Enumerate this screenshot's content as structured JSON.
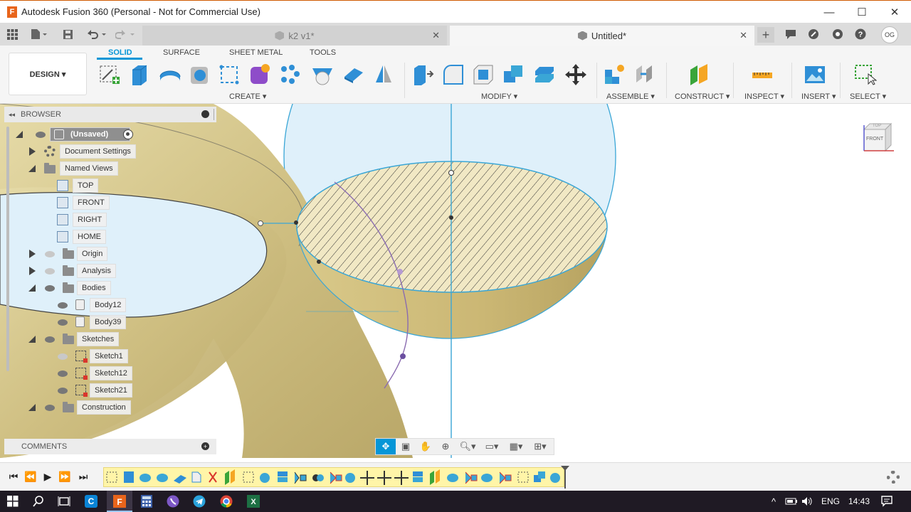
{
  "window": {
    "title": "Autodesk Fusion 360 (Personal - Not for Commercial Use)",
    "logo_letter": "F",
    "controls": [
      "—",
      "☐",
      "✕"
    ]
  },
  "tabs": {
    "inactive_label": "k2 v1*",
    "active_label": "Untitled*",
    "close": "✕",
    "new": "+",
    "user_initials": "OG"
  },
  "toolbar": {
    "design_label": "DESIGN ▾",
    "workspace_tabs": [
      "SOLID",
      "SURFACE",
      "SHEET METAL",
      "TOOLS"
    ],
    "groups": [
      "CREATE ▾",
      "MODIFY ▾",
      "ASSEMBLE ▾",
      "CONSTRUCT ▾",
      "INSPECT ▾",
      "INSERT ▾",
      "SELECT ▾"
    ]
  },
  "browser": {
    "title": "BROWSER",
    "root": "(Unsaved)",
    "items": [
      "Document Settings",
      "Named Views",
      "TOP",
      "FRONT",
      "RIGHT",
      "HOME",
      "Origin",
      "Analysis",
      "Bodies",
      "Body12",
      "Body39",
      "Sketches",
      "Sketch1",
      "Sketch12",
      "Sketch21",
      "Construction"
    ]
  },
  "comments": {
    "label": "COMMENTS"
  },
  "viewcube": {
    "top": "TOP",
    "front": "FRONT"
  },
  "taskbar": {
    "language": "ENG",
    "time": "14:43"
  },
  "colors": {
    "accent": "#0696d7",
    "model_face": "#d9cc96",
    "sketch_line": "#3aa6d6"
  }
}
